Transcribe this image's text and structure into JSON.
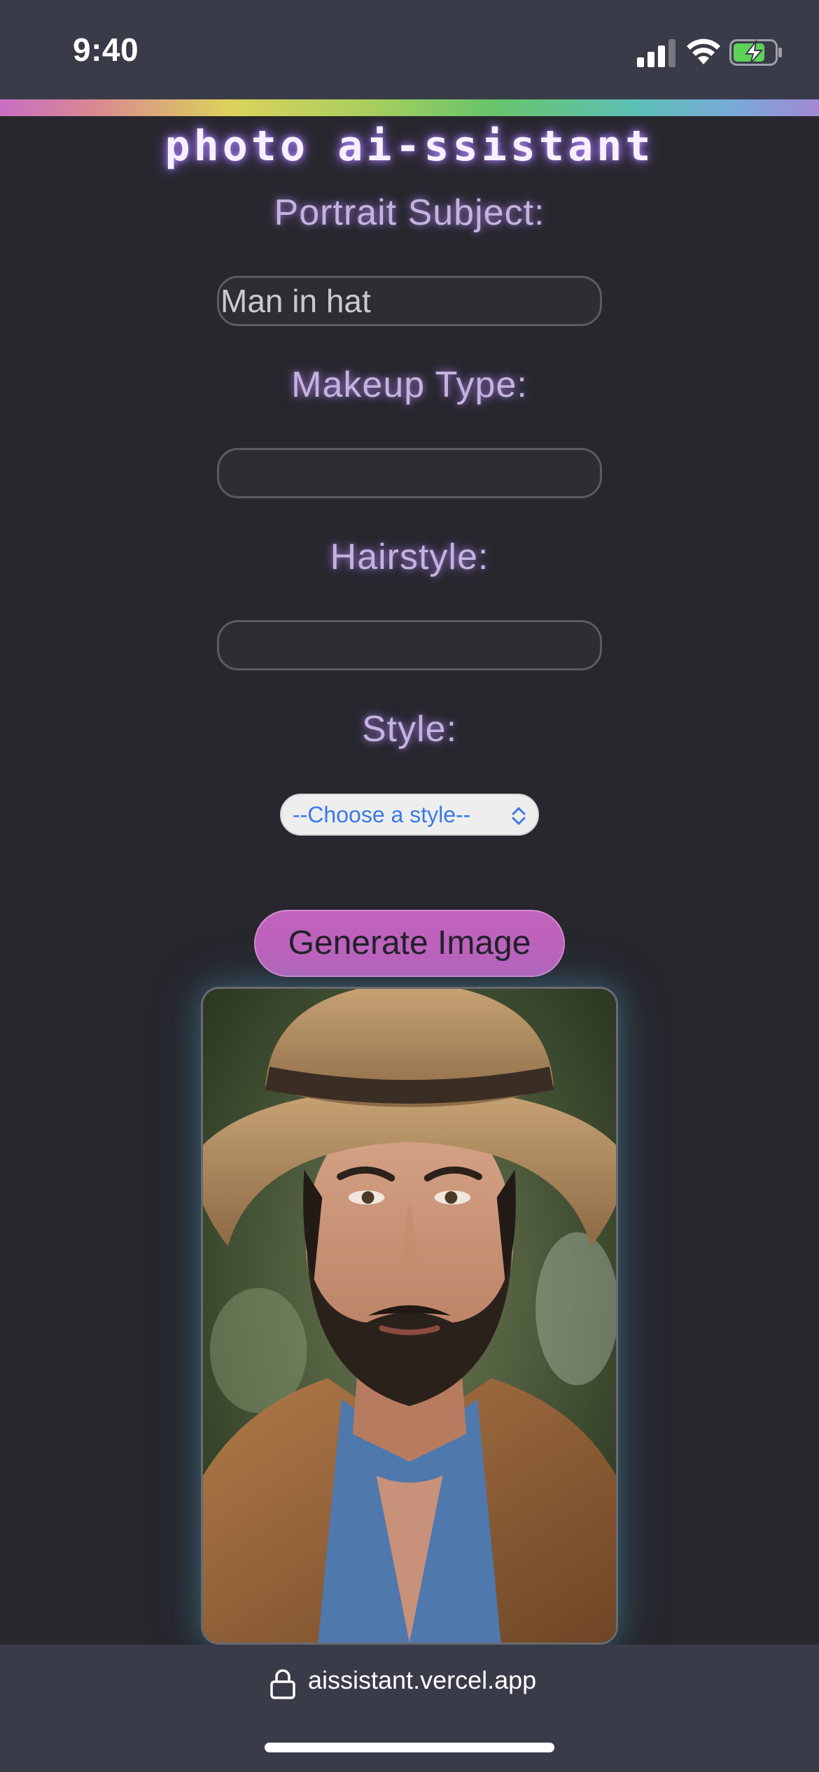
{
  "status_bar": {
    "time": "9:40"
  },
  "app": {
    "title": "photo ai-ssistant"
  },
  "form": {
    "portrait_subject": {
      "label": "Portrait Subject:",
      "value": "Man in hat",
      "placeholder": ""
    },
    "makeup_type": {
      "label": "Makeup Type:",
      "value": "",
      "placeholder": ""
    },
    "hairstyle": {
      "label": "Hairstyle:",
      "value": "",
      "placeholder": ""
    },
    "style": {
      "label": "Style:",
      "selected": "--Choose a style--"
    },
    "generate_label": "Generate Image"
  },
  "result": {
    "image_alt": "Generated portrait of a bearded man in a straw hat and tan jacket"
  },
  "browser": {
    "url": "aissistant.vercel.app"
  },
  "colors": {
    "background": "#27272d",
    "label_glow": "#c4b3df",
    "button": "#bf63bd",
    "select_text": "#3a78e6"
  },
  "icons": [
    "signal-icon",
    "wifi-icon",
    "battery-charging-icon",
    "chevron-updown-icon",
    "lock-icon"
  ]
}
